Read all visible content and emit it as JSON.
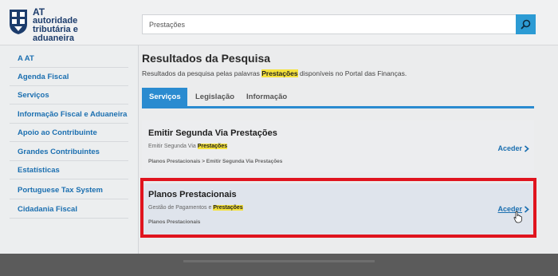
{
  "header": {
    "logo_line1": "AT",
    "logo_line2": "autoridade",
    "logo_line3": "tributária e aduaneira",
    "search_value": "Prestações"
  },
  "sidebar": {
    "items": [
      {
        "label": "A AT"
      },
      {
        "label": "Agenda Fiscal"
      },
      {
        "label": "Serviços"
      },
      {
        "label": "Informação Fiscal e Aduaneira"
      },
      {
        "label": "Apoio ao Contribuinte"
      },
      {
        "label": "Grandes Contribuintes"
      },
      {
        "label": "Estatísticas"
      },
      {
        "label": "Portuguese Tax System"
      },
      {
        "label": "Cidadania Fiscal"
      }
    ]
  },
  "main": {
    "title": "Resultados da Pesquisa",
    "subtitle_prefix": "Resultados da pesquisa pelas palavras ",
    "subtitle_term": "Prestações",
    "subtitle_suffix": " disponíveis no Portal das Finanças.",
    "tabs": [
      {
        "label": "Serviços",
        "active": true
      },
      {
        "label": "Legislação",
        "active": false
      },
      {
        "label": "Informação",
        "active": false
      }
    ],
    "results": [
      {
        "title": "Emitir Segunda Via Prestações",
        "desc_prefix": "Emitir Segunda Via ",
        "desc_term": "Prestações",
        "path": "Planos Prestacionais > Emitir Segunda Via Prestações",
        "link": "Aceder"
      },
      {
        "title": "Planos Prestacionais",
        "desc_prefix": "Gestão de Pagamentos e ",
        "desc_term": "Prestações",
        "path": "Planos Prestacionais",
        "link": "Aceder"
      }
    ]
  },
  "colors": {
    "accent": "#2a8bd0",
    "link": "#1b6fb0",
    "highlight": "#f5e23b",
    "annotation_box": "#e0141e"
  }
}
